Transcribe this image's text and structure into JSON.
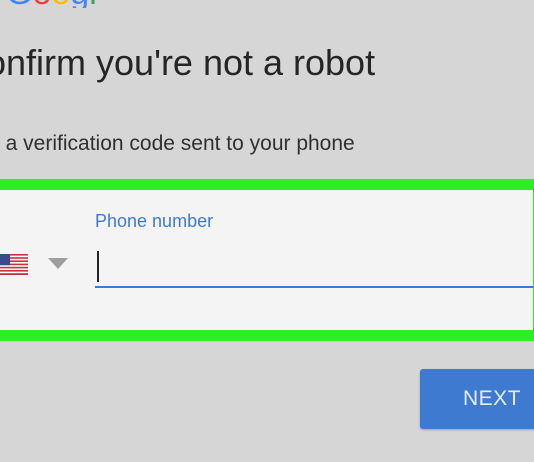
{
  "logo": {
    "text": "Google"
  },
  "page": {
    "title": "onfirm you're not a robot",
    "subtitle": "t a verification code sent to your phone"
  },
  "phone": {
    "label": "Phone number",
    "value": "",
    "country_flag_icon": "us-flag-icon"
  },
  "actions": {
    "next_label": "NEXT"
  },
  "colors": {
    "accent": "#3f79d6",
    "highlight": "#2ded24",
    "background": "#d6d6d6",
    "button": "#3f7ad1"
  }
}
